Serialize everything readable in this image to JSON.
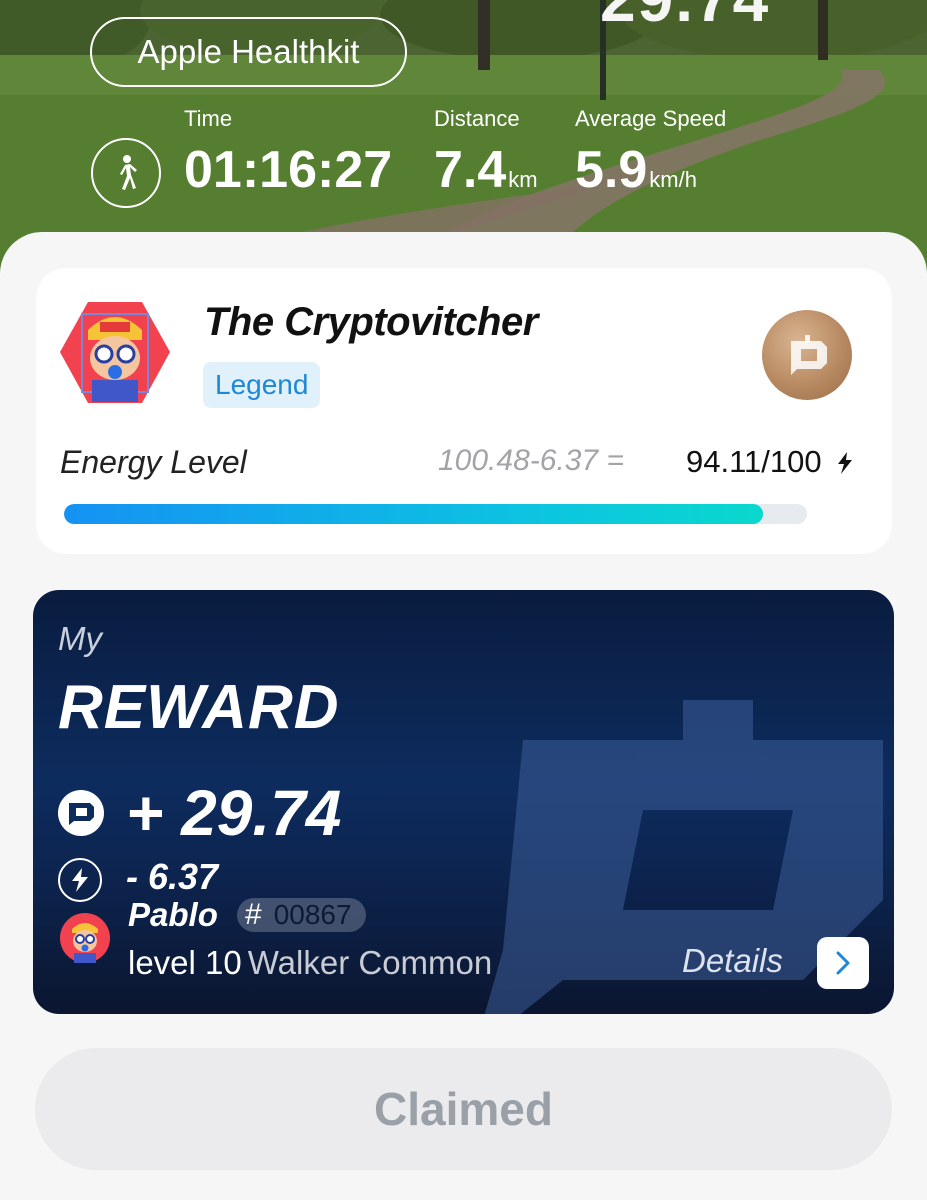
{
  "header": {
    "top_value": "29.74",
    "source_label": "Apple Healthkit",
    "walk_icon": "walking-person-icon",
    "stats": {
      "time": {
        "label": "Time",
        "value": "01:16:27"
      },
      "distance": {
        "label": "Distance",
        "value": "7.4",
        "unit": "km"
      },
      "speed": {
        "label": "Average Speed",
        "value": "5.9",
        "unit": "km/h"
      }
    }
  },
  "profile": {
    "name": "The Cryptovitcher",
    "rank": "Legend",
    "coin_icon": "crypto-coin-icon",
    "energy": {
      "label": "Energy Level",
      "formula": "100.48-6.37 =",
      "value": "94.11/100",
      "fraction": 0.9411,
      "icon": "lightning-icon"
    }
  },
  "reward": {
    "my_label": "My",
    "title": "REWARD",
    "amount": "+ 29.74",
    "energy_cost": "- 6.37",
    "walker": {
      "name": "Pablo",
      "id_prefix": "#",
      "id": "00867",
      "level": "level 10",
      "class": "Walker Common"
    },
    "details_label": "Details"
  },
  "claim_button_label": "Claimed",
  "colors": {
    "accent": "#1e88d6",
    "rank_bg": "#e0f1fb",
    "bar_start": "#1592f3",
    "bar_end": "#0ad8cc",
    "reward_bg": "#0d2c5e",
    "coin": "#b88a62",
    "claimed_bg": "#ebebed",
    "claimed_text": "#9aa0a8"
  }
}
